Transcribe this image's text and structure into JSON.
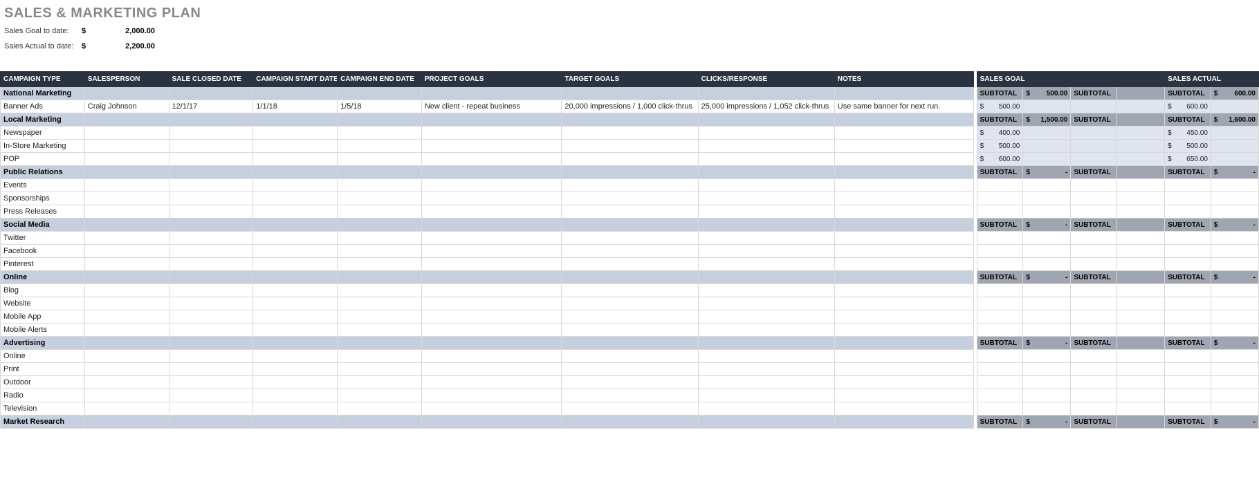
{
  "title": "SALES & MARKETING PLAN",
  "summary": {
    "goal_label": "Sales Goal to date:",
    "goal_value": "2,000.00",
    "actual_label": "Sales Actual to date:",
    "actual_value": "2,200.00",
    "currency": "$"
  },
  "headers": {
    "campaign_type": "CAMPAIGN TYPE",
    "salesperson": "SALESPERSON",
    "sale_closed_date": "SALE CLOSED DATE",
    "campaign_start_date": "CAMPAIGN START DATE",
    "campaign_end_date": "CAMPAIGN END DATE",
    "project_goals": "PROJECT GOALS",
    "target_goals": "TARGET GOALS",
    "clicks_response": "CLICKS/RESPONSE",
    "notes": "NOTES",
    "sales_goal": "SALES GOAL",
    "sales_next": "",
    "sales_actual": "SALES ACTUAL"
  },
  "subtotal_label": "SUBTOTAL",
  "currency": "$",
  "dash": "-",
  "sections": [
    {
      "name": "National Marketing",
      "goal": "500.00",
      "actual": "600.00",
      "rows": [
        {
          "type": "Banner Ads",
          "salesperson": "Craig Johnson",
          "closed": "12/1/17",
          "start": "1/1/18",
          "end": "1/5/18",
          "project": "New client - repeat business",
          "target": "20,000 impressions / 1,000 click-thrus",
          "clicks": "25,000 impressions / 1,052 click-thrus",
          "notes": "Use same banner for next run.",
          "goal": "500.00",
          "actual": "600.00"
        }
      ]
    },
    {
      "name": "Local Marketing",
      "goal": "1,500.00",
      "actual": "1,600.00",
      "rows": [
        {
          "type": "Newspaper",
          "goal": "400.00",
          "actual": "450.00"
        },
        {
          "type": "In-Store Marketing",
          "goal": "500.00",
          "actual": "500.00"
        },
        {
          "type": "POP",
          "goal": "600.00",
          "actual": "650.00"
        }
      ]
    },
    {
      "name": "Public Relations",
      "goal": "-",
      "actual": "-",
      "rows": [
        {
          "type": "Events",
          "money_white": true
        },
        {
          "type": "Sponsorships",
          "money_white": true
        },
        {
          "type": "Press Releases",
          "money_white": true
        }
      ]
    },
    {
      "name": "Social Media",
      "goal": "-",
      "actual": "-",
      "rows": [
        {
          "type": "Twitter",
          "money_white": true
        },
        {
          "type": "Facebook",
          "money_white": true
        },
        {
          "type": "Pinterest",
          "money_white": true
        }
      ]
    },
    {
      "name": "Online",
      "goal": "-",
      "actual": "-",
      "rows": [
        {
          "type": "Blog",
          "money_white": true
        },
        {
          "type": "Website",
          "money_white": true
        },
        {
          "type": "Mobile App",
          "money_white": true
        },
        {
          "type": "Mobile Alerts",
          "money_white": true
        }
      ]
    },
    {
      "name": "Advertising",
      "goal": "-",
      "actual": "-",
      "rows": [
        {
          "type": "Online",
          "money_white": true
        },
        {
          "type": "Print",
          "money_white": true
        },
        {
          "type": "Outdoor",
          "money_white": true
        },
        {
          "type": "Radio",
          "money_white": true
        },
        {
          "type": "Television",
          "money_white": true
        }
      ]
    },
    {
      "name": "Market Research",
      "goal": "-",
      "actual": "-",
      "rows": []
    }
  ]
}
